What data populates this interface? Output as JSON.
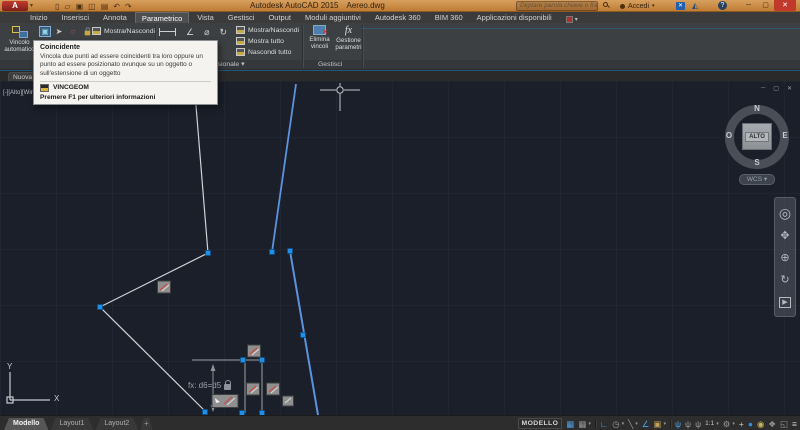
{
  "colors": {
    "titlebar_orange": "#c98a45",
    "accent_blue": "#4da3e8",
    "selection_line_blue": "#5b93dd",
    "grip_blue": "#1f8fe8",
    "canvas_bg": "#1a1f29",
    "ribbon_bg": "#3d4042",
    "close_red": "#c0392b",
    "tooltip_bg": "#f4f3ef"
  },
  "title_bar": {
    "logo": "A",
    "title": "Autodesk AutoCAD 2015",
    "doc_name": "Aereo.dwg",
    "search_placeholder": "Digitare parola chiave o frase",
    "sign_in": "Accedi",
    "qat": {
      "new": "▯",
      "open": "▱",
      "save": "▣",
      "save_as": "◫",
      "plot": "▤",
      "undo": "↶",
      "redo": "↷"
    },
    "window": {
      "minimize": "─",
      "restore": "▢",
      "close": "✕"
    }
  },
  "ribbon_tabs": {
    "items": [
      "Inizio",
      "Inserisci",
      "Annota",
      "Parametrico",
      "Vista",
      "Gestisci",
      "Output",
      "Moduli aggiuntivi",
      "Autodesk 360",
      "BIM 360",
      "Applicazioni disponibili"
    ],
    "active": "Parametrico"
  },
  "ribbon": {
    "auto_constrain": "Vincolo automatico",
    "geometric_show_hide": "Mostra/Nascondi",
    "dim_show_hide": "Mostra/Nascondi",
    "dim_show_all": "Mostra tutto",
    "dim_hide_all": "Nascondi tutto",
    "delete_constraints": "Elimina vincoli",
    "parameters_manager": "Gestione parametri",
    "panel_dimensional": "Dimensionale",
    "panel_manage": "Gestisci",
    "fx_glyph": "fx",
    "cursor_glyph": "➤",
    "tangent_glyph": "○",
    "diameter_glyph": "⌀",
    "angle_glyph": "∠",
    "orbit_glyph": "↻"
  },
  "tooltip": {
    "title": "Coincidente",
    "body": "Vincola due punti ad essere coincidenti tra loro oppure un punto ad essere posizionato ovunque su un oggetto o sull'estensione di un oggetto",
    "command": "VINCGEOM",
    "footer": "Premere F1 per ulteriori informazioni"
  },
  "file_tabs": {
    "tab": "Nuova scheda"
  },
  "canvas": {
    "viewport_label": "[-][Alto][Wireframe 2D]",
    "fx_label": "fx: d6=d5",
    "viewcube": {
      "north": "N",
      "east": "E",
      "south": "S",
      "west": "O",
      "face": "ALTO",
      "wcs": "WCS"
    },
    "ucs": {
      "x": "X",
      "y": "Y"
    },
    "window_controls": {
      "minimize": "─",
      "restore": "▢",
      "close": "✕"
    },
    "navbar": {
      "wheel": "◎",
      "pan": "✥",
      "zoom": "⊕",
      "orbit": "↻",
      "showmotion": "▶"
    }
  },
  "status_bar": {
    "model_tabs": [
      "Modello",
      "Layout1",
      "Layout2"
    ],
    "new_layout_button": "+",
    "space_label": "MODELLO",
    "icons": [
      {
        "name": "grid",
        "glyph": "▦"
      },
      {
        "name": "snap",
        "glyph": "▦"
      },
      {
        "name": "ortho",
        "glyph": "∟"
      },
      {
        "name": "polar-tracking",
        "glyph": "◷"
      },
      {
        "name": "isometric-drafting",
        "glyph": "╲"
      },
      {
        "name": "object-snap-tracking",
        "glyph": "∠"
      },
      {
        "name": "object-snap",
        "glyph": "▣"
      },
      {
        "name": "annotation-visibility",
        "glyph": "ψ"
      },
      {
        "name": "annotation-autoscale",
        "glyph": "ψ"
      },
      {
        "name": "annotation-scale",
        "glyph": "ψ"
      },
      {
        "name": "annotation-scale-value",
        "glyph": "1:1"
      },
      {
        "name": "workspace-switching",
        "glyph": "⚙"
      },
      {
        "name": "annotation-monitor",
        "glyph": "+"
      },
      {
        "name": "hardware-acceleration",
        "glyph": "●"
      },
      {
        "name": "isolate-objects",
        "glyph": "◉"
      },
      {
        "name": "graphics-performance",
        "glyph": "❖"
      },
      {
        "name": "clean-screen",
        "glyph": "◱"
      },
      {
        "name": "customization",
        "glyph": "≡"
      }
    ]
  }
}
